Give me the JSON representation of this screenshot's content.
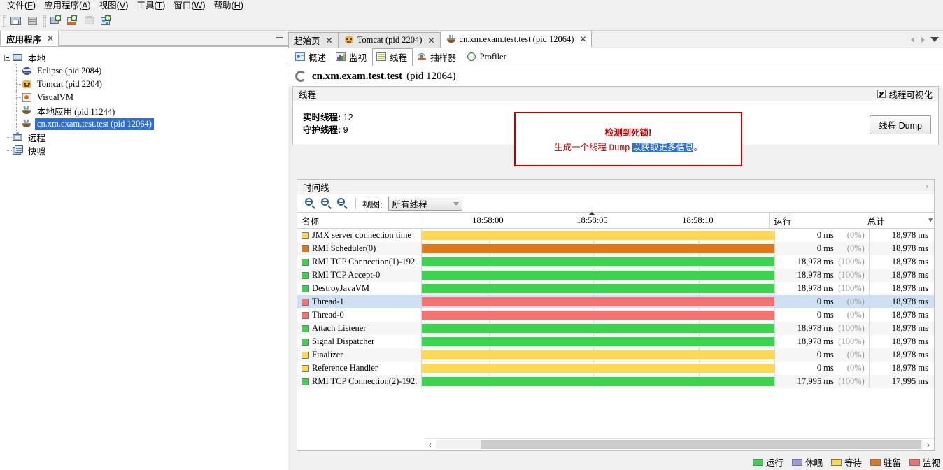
{
  "menubar": [
    {
      "label": "文件(F)",
      "name": "menu-file"
    },
    {
      "label": "应用程序(A)",
      "name": "menu-applications"
    },
    {
      "label": "视图(V)",
      "name": "menu-view"
    },
    {
      "label": "工具(T)",
      "name": "menu-tools"
    },
    {
      "label": "窗口(W)",
      "name": "menu-window"
    },
    {
      "label": "帮助(H)",
      "name": "menu-help"
    }
  ],
  "toolbar": {
    "buttons": [
      {
        "name": "load-snapshot-icon"
      },
      {
        "name": "save-snapshot-icon"
      },
      {
        "name": "add-remote-host-icon"
      },
      {
        "name": "add-jmx-connection-icon"
      },
      {
        "name": "stop-icon"
      },
      {
        "name": "add-application-icon"
      }
    ]
  },
  "sidebar": {
    "tab_label": "应用程序",
    "tab_close": "✕",
    "tree": [
      {
        "label": "本地",
        "icon": "computer-icon",
        "level": 0,
        "selected": false,
        "expander": true
      },
      {
        "label": "Eclipse (pid 2084)",
        "icon": "eclipse-icon",
        "level": 1,
        "selected": false
      },
      {
        "label": "Tomcat (pid 2204)",
        "icon": "tomcat-icon",
        "level": 1,
        "selected": false
      },
      {
        "label": "VisualVM",
        "icon": "visualvm-icon",
        "level": 1,
        "selected": false
      },
      {
        "label": "本地应用 (pid 11244)",
        "icon": "java-icon",
        "level": 1,
        "selected": false
      },
      {
        "label": "cn.xm.exam.test.test (pid 12064)",
        "icon": "java-icon",
        "level": 1,
        "selected": true
      },
      {
        "label": "远程",
        "icon": "remote-icon",
        "level": 0,
        "selected": false
      },
      {
        "label": "快照",
        "icon": "snapshot-icon",
        "level": 0,
        "selected": false
      }
    ]
  },
  "doctabs": [
    {
      "label": "起始页",
      "icon": "",
      "active": false,
      "close": "✕"
    },
    {
      "label": "Tomcat (pid 2204)",
      "icon": "tomcat-icon",
      "active": false,
      "close": "✕"
    },
    {
      "label": "cn.xm.exam.test.test (pid 12064)",
      "icon": "java-icon",
      "active": true,
      "close": "✕"
    }
  ],
  "subtabs": [
    {
      "label": "概述",
      "icon": "overview-icon",
      "active": false
    },
    {
      "label": "监视",
      "icon": "monitor-icon",
      "active": false
    },
    {
      "label": "线程",
      "icon": "threads-icon",
      "active": true
    },
    {
      "label": "抽样器",
      "icon": "sampler-icon",
      "active": false
    },
    {
      "label": "Profiler",
      "icon": "profiler-icon",
      "active": false
    }
  ],
  "app_title": {
    "name": "cn.xm.exam.test.test",
    "pid": "(pid 12064)"
  },
  "threads_section": {
    "header": "线程",
    "visualize_label": "线程可视化",
    "visualize_checked": true,
    "live_label": "实时线程:",
    "live_value": "12",
    "daemon_label": "守护线程:",
    "daemon_value": "9",
    "dump_button": "线程 Dump",
    "warning": {
      "line1": "检测到死锁!",
      "line2_a": "生成一个线程 ",
      "line2_dump": "Dump",
      "line2_b": " ",
      "line2_highlight": "以获取更多信息",
      "line2_c": "。",
      "border_color": "#c00000",
      "text_color": "#c00000"
    }
  },
  "timeline_section": {
    "header": "时间线",
    "view_label": "视图:",
    "view_value": "所有线程",
    "zoom_in": "zoom-in-icon",
    "zoom_out": "zoom-out-icon",
    "zoom_fit": "zoom-fit-icon",
    "columns": [
      "名称",
      "运行",
      "总计"
    ],
    "ticks": [
      "18:58:00",
      "18:58:05",
      "18:58:10"
    ]
  },
  "chart_data": {
    "type": "timeline",
    "title": "线程时间线",
    "xlabel": "",
    "ylabel": "",
    "tick_labels": [
      "18:58:00",
      "18:58:05",
      "18:58:10"
    ],
    "state_colors": {
      "运行": "#3ad44d",
      "休眠": "#9a9ae0",
      "等待": "#ffd94d",
      "驻留": "#e07818",
      "监视": "#f87171"
    },
    "columns": [
      "名称",
      "运行",
      "总计"
    ],
    "rows": [
      {
        "name": "JMX server connection time",
        "state": "等待",
        "color": "#ffd94d",
        "running": "0 ms",
        "pct": "(0%)",
        "total": "18,978 ms",
        "selected": false
      },
      {
        "name": "RMI Scheduler(0)",
        "state": "驻留",
        "color": "#e07818",
        "running": "0 ms",
        "pct": "(0%)",
        "total": "18,978 ms",
        "selected": false
      },
      {
        "name": "RMI TCP Connection(1)-192.",
        "state": "运行",
        "color": "#3ad44d",
        "running": "18,978 ms",
        "pct": "(100%)",
        "total": "18,978 ms",
        "selected": false
      },
      {
        "name": "RMI TCP Accept-0",
        "state": "运行",
        "color": "#3ad44d",
        "running": "18,978 ms",
        "pct": "(100%)",
        "total": "18,978 ms",
        "selected": false
      },
      {
        "name": "DestroyJavaVM",
        "state": "运行",
        "color": "#3ad44d",
        "running": "18,978 ms",
        "pct": "(100%)",
        "total": "18,978 ms",
        "selected": false
      },
      {
        "name": "Thread-1",
        "state": "监视",
        "color": "#f87171",
        "running": "0 ms",
        "pct": "(0%)",
        "total": "18,978 ms",
        "selected": true
      },
      {
        "name": "Thread-0",
        "state": "监视",
        "color": "#f87171",
        "running": "0 ms",
        "pct": "(0%)",
        "total": "18,978 ms",
        "selected": false
      },
      {
        "name": "Attach Listener",
        "state": "运行",
        "color": "#3ad44d",
        "running": "18,978 ms",
        "pct": "(100%)",
        "total": "18,978 ms",
        "selected": false
      },
      {
        "name": "Signal Dispatcher",
        "state": "运行",
        "color": "#3ad44d",
        "running": "18,978 ms",
        "pct": "(100%)",
        "total": "18,978 ms",
        "selected": false
      },
      {
        "name": "Finalizer",
        "state": "等待",
        "color": "#ffd94d",
        "running": "0 ms",
        "pct": "(0%)",
        "total": "18,978 ms",
        "selected": false
      },
      {
        "name": "Reference Handler",
        "state": "等待",
        "color": "#ffd94d",
        "running": "0 ms",
        "pct": "(0%)",
        "total": "18,978 ms",
        "selected": false
      },
      {
        "name": "RMI TCP Connection(2)-192.",
        "state": "运行",
        "color": "#3ad44d",
        "running": "17,995 ms",
        "pct": "(100%)",
        "total": "17,995 ms",
        "selected": false
      }
    ]
  },
  "legend": [
    {
      "label": "运行",
      "color": "#3ad44d"
    },
    {
      "label": "休眠",
      "color": "#9a9ae0"
    },
    {
      "label": "等待",
      "color": "#ffd94d"
    },
    {
      "label": "驻留",
      "color": "#e07818"
    },
    {
      "label": "监视",
      "color": "#f87171"
    }
  ],
  "scrollbar": {
    "left_arrow": "‹",
    "right_arrow": "›"
  }
}
